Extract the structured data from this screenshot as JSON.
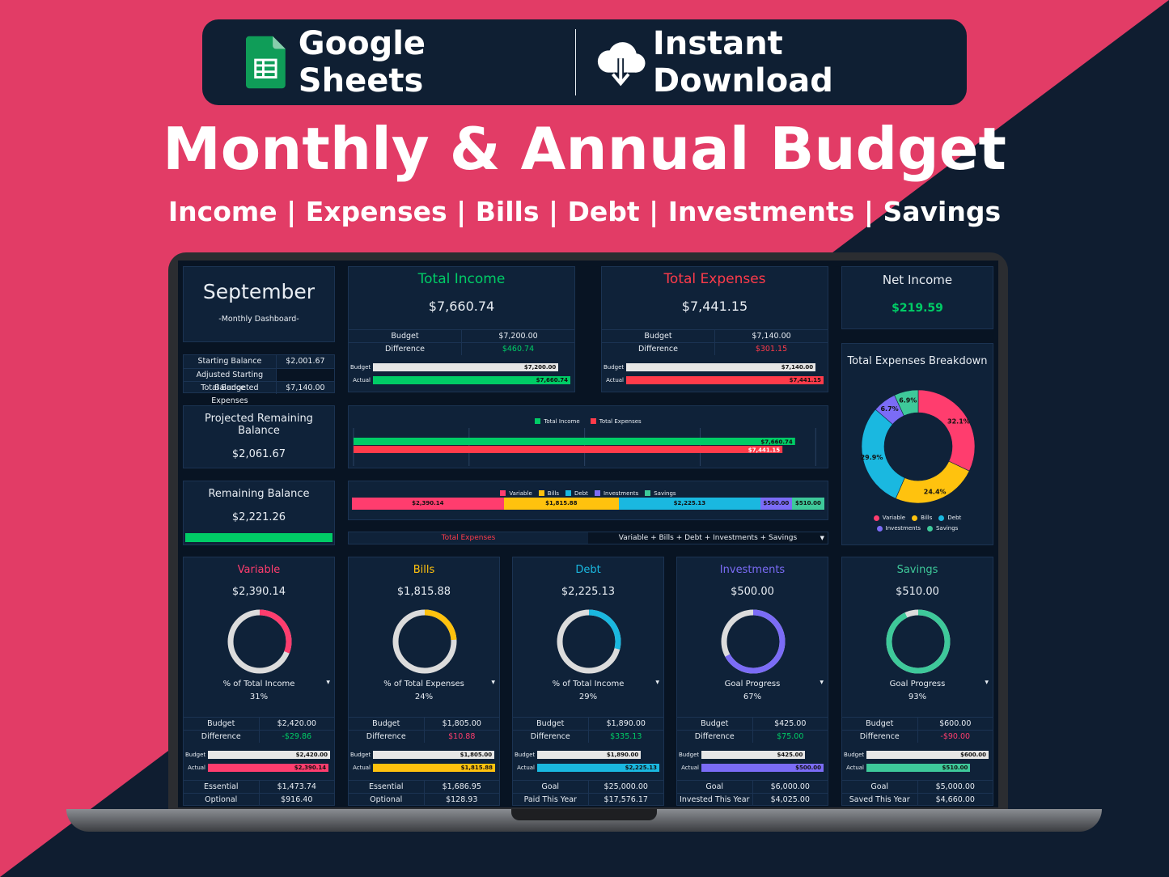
{
  "banner": {
    "sheets_label": "Google Sheets",
    "download_label": "Instant Download"
  },
  "title": "Monthly & Annual Budget",
  "subtitle": "Income | Expenses | Bills | Debt | Investments | Savings",
  "colors": {
    "income": "#00cc66",
    "expenses": "#ff3b4a",
    "variable": "#ff3d6e",
    "bills": "#ffc20e",
    "debt": "#1ab8e0",
    "investments": "#7b6cf6",
    "savings": "#3ec99a"
  },
  "month": {
    "name": "September",
    "caption": "-Monthly Dashboard-"
  },
  "balances": [
    {
      "label": "Starting Balance",
      "value": "$2,001.67"
    },
    {
      "label": "Adjusted Starting Balance",
      "value": ""
    },
    {
      "label": "Total Budgeted Expenses",
      "value": "$7,140.00"
    }
  ],
  "projected": {
    "label": "Projected Remaining Balance",
    "value": "$2,061.67"
  },
  "remaining": {
    "label": "Remaining Balance",
    "value": "$2,221.26",
    "progress": 1.0
  },
  "income": {
    "title": "Total Income",
    "amount": "$7,660.74",
    "budget_label": "Budget",
    "budget": "$7,200.00",
    "diff_label": "Difference",
    "diff": "$460.74",
    "bar_budget": "$7,200.00",
    "bar_actual": "$7,660.74",
    "budget_value": 7200,
    "actual_value": 7660.74
  },
  "expenses": {
    "title": "Total Expenses",
    "amount": "$7,441.15",
    "budget_label": "Budget",
    "budget": "$7,140.00",
    "diff_label": "Difference",
    "diff": "$301.15",
    "bar_budget": "$7,140.00",
    "bar_actual": "$7,441.15",
    "budget_value": 7140,
    "actual_value": 7441.15
  },
  "bar_labels": {
    "budget": "Budget",
    "actual": "Actual"
  },
  "net": {
    "title": "Net Income",
    "amount": "$219.59"
  },
  "compare_chart": {
    "legend": [
      "Total Income",
      "Total Expenses"
    ],
    "labels": [
      "$7,660.74",
      "$7,441.15"
    ]
  },
  "selector": {
    "label": "Total Expenses",
    "value": "Variable + Bills + Debt + Investments + Savings"
  },
  "chart_data": [
    {
      "type": "bar",
      "orientation": "horizontal",
      "categories": [
        "Total Income",
        "Total Expenses"
      ],
      "values": [
        7660.74,
        7441.15
      ],
      "legend": "top",
      "grid": true
    },
    {
      "type": "bar",
      "stacked": true,
      "orientation": "horizontal",
      "categories": [
        "Variable",
        "Bills",
        "Debt",
        "Investments",
        "Savings"
      ],
      "values": [
        2390.14,
        1815.88,
        2225.13,
        500.0,
        510.0
      ],
      "labels": [
        "$2,390.14",
        "$1,815.88",
        "$2,225.13",
        "$500.00",
        "$510.00"
      ],
      "legend": "top"
    },
    {
      "type": "pie",
      "donut": true,
      "title": "Total Expenses Breakdown",
      "categories": [
        "Variable",
        "Bills",
        "Debt",
        "Investments",
        "Savings"
      ],
      "values": [
        32.1,
        24.4,
        29.9,
        6.7,
        6.9
      ],
      "labels": [
        "32.1%",
        "24.4%",
        "29.9%",
        "6.7%",
        "6.9%"
      ],
      "legend": "bottom"
    }
  ],
  "cards": [
    {
      "key": "variable",
      "title": "Variable",
      "amount": "$2,390.14",
      "metric": "% of Total Income",
      "pct": "31%",
      "progress": 0.31,
      "budget_label": "Budget",
      "budget": "$2,420.00",
      "diff_label": "Difference",
      "diff": "-$29.86",
      "diff_color": "#00cc66",
      "bar_budget": "$2,420.00",
      "bar_actual": "$2,390.14",
      "budget_value": 2420,
      "actual_value": 2390.14,
      "r1_label": "Essential",
      "r1": "$1,473.74",
      "r2_label": "Optional",
      "r2": "$916.40"
    },
    {
      "key": "bills",
      "title": "Bills",
      "amount": "$1,815.88",
      "metric": "% of Total Expenses",
      "pct": "24%",
      "progress": 0.24,
      "budget_label": "Budget",
      "budget": "$1,805.00",
      "diff_label": "Difference",
      "diff": "$10.88",
      "diff_color": "#ff3d6e",
      "bar_budget": "$1,805.00",
      "bar_actual": "$1,815.88",
      "budget_value": 1805,
      "actual_value": 1815.88,
      "r1_label": "Essential",
      "r1": "$1,686.95",
      "r2_label": "Optional",
      "r2": "$128.93"
    },
    {
      "key": "debt",
      "title": "Debt",
      "amount": "$2,225.13",
      "metric": "% of Total Income",
      "pct": "29%",
      "progress": 0.29,
      "budget_label": "Budget",
      "budget": "$1,890.00",
      "diff_label": "Difference",
      "diff": "$335.13",
      "diff_color": "#00cc66",
      "bar_budget": "$1,890.00",
      "bar_actual": "$2,225.13",
      "budget_value": 1890,
      "actual_value": 2225.13,
      "r1_label": "Goal",
      "r1": "$25,000.00",
      "r2_label": "Paid This Year",
      "r2": "$17,576.17"
    },
    {
      "key": "investments",
      "title": "Investments",
      "amount": "$500.00",
      "metric": "Goal Progress",
      "pct": "67%",
      "progress": 0.67,
      "budget_label": "Budget",
      "budget": "$425.00",
      "diff_label": "Difference",
      "diff": "$75.00",
      "diff_color": "#00cc66",
      "bar_budget": "$425.00",
      "bar_actual": "$500.00",
      "budget_value": 425,
      "actual_value": 500,
      "r1_label": "Goal",
      "r1": "$6,000.00",
      "r2_label": "Invested This Year",
      "r2": "$4,025.00"
    },
    {
      "key": "savings",
      "title": "Savings",
      "amount": "$510.00",
      "metric": "Goal Progress",
      "pct": "93%",
      "progress": 0.93,
      "budget_label": "Budget",
      "budget": "$600.00",
      "diff_label": "Difference",
      "diff": "-$90.00",
      "diff_color": "#ff3d6e",
      "bar_budget": "$600.00",
      "bar_actual": "$510.00",
      "budget_value": 600,
      "actual_value": 510,
      "r1_label": "Goal",
      "r1": "$5,000.00",
      "r2_label": "Saved This Year",
      "r2": "$4,660.00"
    }
  ]
}
